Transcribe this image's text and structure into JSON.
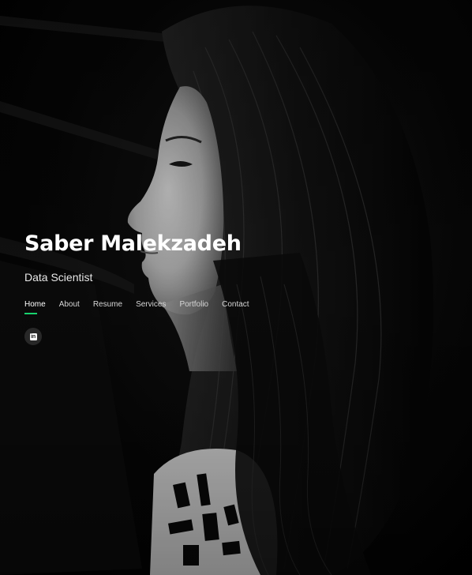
{
  "hero": {
    "name": "Saber Malekzadeh",
    "role": "Data Scientist",
    "background_image": "black-and-white portrait of a woman in profile",
    "accent_color": "#18d26e"
  },
  "nav": {
    "items": [
      {
        "label": "Home",
        "active": true
      },
      {
        "label": "About",
        "active": false
      },
      {
        "label": "Resume",
        "active": false
      },
      {
        "label": "Services",
        "active": false
      },
      {
        "label": "Portfolio",
        "active": false
      },
      {
        "label": "Contact",
        "active": false
      }
    ]
  },
  "social": {
    "items": [
      {
        "icon": "linkedin-icon",
        "glyph": "in"
      }
    ]
  }
}
